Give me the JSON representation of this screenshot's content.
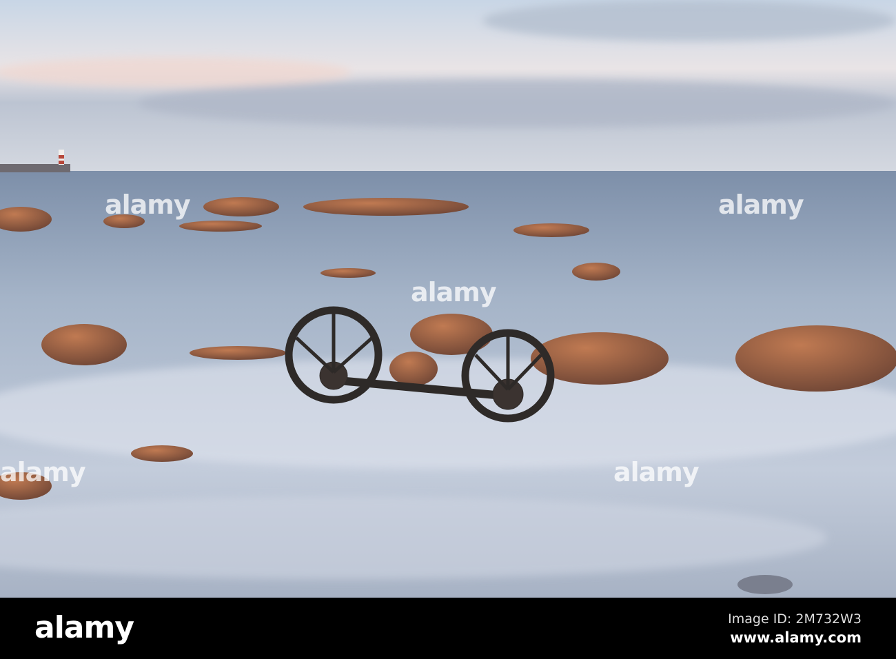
{
  "photo": {
    "subject": "Old cart wheels in misty sea among rocks with lighthouse",
    "watermark_text": "alamy"
  },
  "footer": {
    "logo": "alamy",
    "image_id": "Image ID: 2M732W3",
    "site": "www.alamy.com"
  },
  "colors": {
    "sky_top": "#c9d6e4",
    "sea": "#8fa3bc",
    "rock": "#9a5a3c",
    "footer": "#000000"
  }
}
